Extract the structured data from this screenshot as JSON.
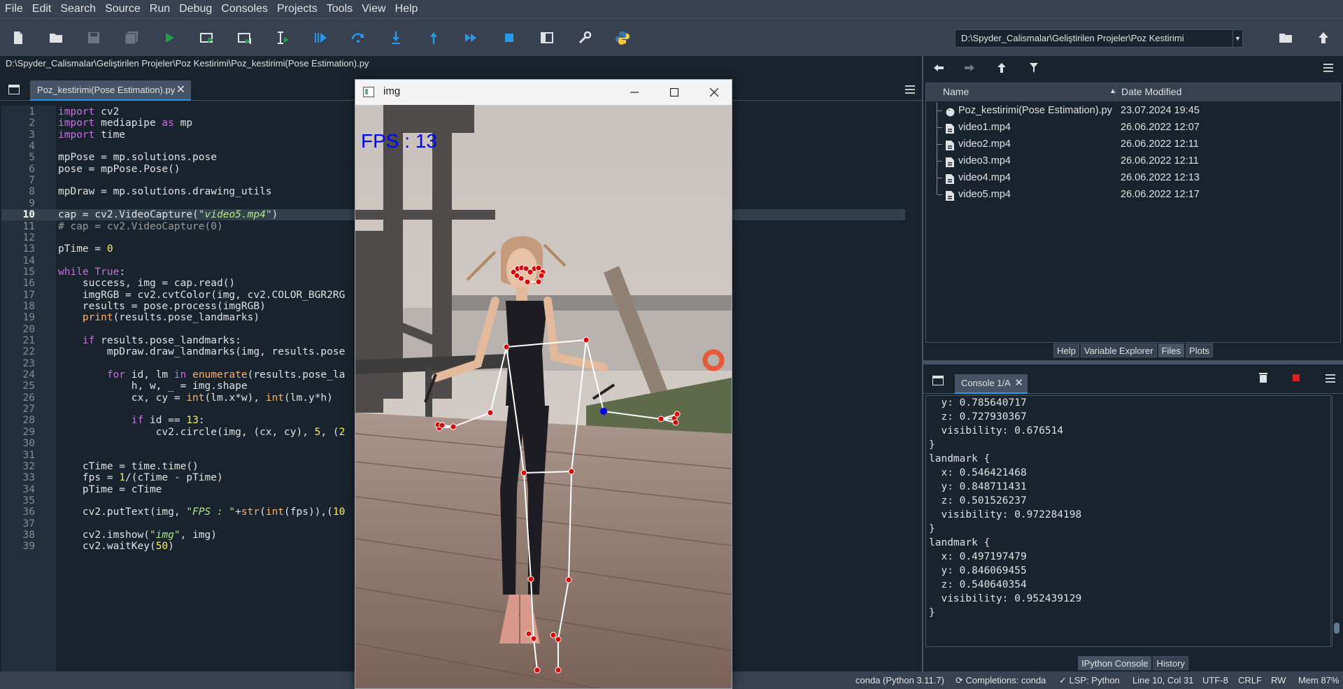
{
  "menubar": [
    "File",
    "Edit",
    "Search",
    "Source",
    "Run",
    "Debug",
    "Consoles",
    "Projects",
    "Tools",
    "View",
    "Help"
  ],
  "toolbar": {
    "icons": [
      "new-file-icon",
      "open-file-icon",
      "save-icon",
      "save-all-icon",
      "run-icon",
      "run-cell-icon",
      "run-cell-advance-icon",
      "run-selection-icon",
      "debug-icon",
      "step-over-icon",
      "step-into-icon",
      "step-return-icon",
      "continue-icon",
      "stop-debug-icon",
      "maximize-pane-icon",
      "preferences-icon",
      "python-path-icon"
    ],
    "working_directory": "D:\\Spyder_Calismalar\\Geliştirilen Projeler\\Poz Kestirimi"
  },
  "editor": {
    "file_path": "D:\\Spyder_Calismalar\\Geliştirilen Projeler\\Poz Kestirimi\\Poz_kestirimi(Pose Estimation).py",
    "tab_label": "Poz_kestirimi(Pose Estimation).py",
    "current_line": 10,
    "lines": [
      "import cv2",
      "import mediapipe as mp",
      "import time",
      "",
      "mpPose = mp.solutions.pose",
      "pose = mpPose.Pose()",
      "",
      "mpDraw = mp.solutions.drawing_utils",
      "",
      "cap = cv2.VideoCapture(\"video5.mp4\")",
      "# cap = cv2.VideoCapture(0)",
      "",
      "pTime = 0",
      "",
      "while True:",
      "    success, img = cap.read()",
      "    imgRGB = cv2.cvtColor(img, cv2.COLOR_BGR2RG",
      "    results = pose.process(imgRGB)",
      "    print(results.pose_landmarks)",
      "",
      "    if results.pose_landmarks:",
      "        mpDraw.draw_landmarks(img, results.pose",
      "",
      "        for id, lm in enumerate(results.pose_la",
      "            h, w, _ = img.shape",
      "            cx, cy = int(lm.x*w), int(lm.y*h)",
      "",
      "            if id == 13:",
      "                cv2.circle(img, (cx, cy), 5, (2",
      "",
      "",
      "    cTime = time.time()",
      "    fps = 1/(cTime - pTime)",
      "    pTime = cTime",
      "",
      "    cv2.putText(img, \"FPS : \"+str(int(fps)),(10",
      "",
      "    cv2.imshow(\"img\", img)",
      "    cv2.waitKey(50)"
    ]
  },
  "files": {
    "header": {
      "name": "Name",
      "date": "Date Modified"
    },
    "rows": [
      {
        "name": "Poz_kestirimi(Pose Estimation).py",
        "date": "23.07.2024 19:45",
        "icon": "python-file-icon"
      },
      {
        "name": "video1.mp4",
        "date": "26.06.2022 12:07",
        "icon": "file-icon"
      },
      {
        "name": "video2.mp4",
        "date": "26.06.2022 12:11",
        "icon": "file-icon"
      },
      {
        "name": "video3.mp4",
        "date": "26.06.2022 12:11",
        "icon": "file-icon"
      },
      {
        "name": "video4.mp4",
        "date": "26.06.2022 12:13",
        "icon": "file-icon"
      },
      {
        "name": "video5.mp4",
        "date": "26.06.2022 12:17",
        "icon": "file-icon"
      }
    ],
    "bottom_tabs": [
      "Help",
      "Variable Explorer",
      "Files",
      "Plots"
    ],
    "active_tab": "Files"
  },
  "console": {
    "tab_label": "Console 1/A",
    "lines": [
      "  y: 0.785640717",
      "  z: 0.727930367",
      "  visibility: 0.676514",
      "}",
      "landmark {",
      "  x: 0.546421468",
      "  y: 0.848711431",
      "  z: 0.501526237",
      "  visibility: 0.972284198",
      "}",
      "landmark {",
      "  x: 0.497197479",
      "  y: 0.846069455",
      "  z: 0.540640354",
      "  visibility: 0.952439129",
      "}"
    ],
    "bottom_tabs": [
      "IPython Console",
      "History"
    ],
    "active_tab": "IPython Console"
  },
  "statusbar": {
    "env": "conda (Python 3.11.7)",
    "completions": "Completions: conda",
    "lsp": "LSP: Python",
    "position": "Line 10, Col 31",
    "encoding": "UTF-8",
    "eol": "CRLF",
    "permissions": "RW",
    "memory": "Mem 87%"
  },
  "img_window": {
    "title": "img",
    "fps_text": "FPS : 13",
    "landmark_color": "#e00000",
    "highlight_color": "#0000ff"
  },
  "colors": {
    "background": "#19232d",
    "panel": "#37414f",
    "accent": "#259ae9"
  }
}
